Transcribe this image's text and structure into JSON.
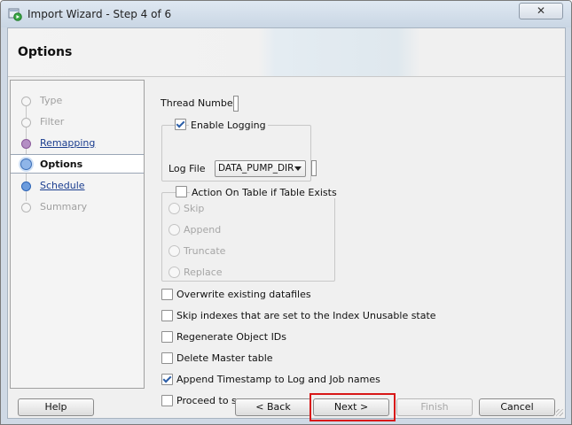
{
  "window": {
    "title": "Import Wizard - Step 4 of 6",
    "close_label": "✕"
  },
  "header": {
    "title": "Options"
  },
  "nav": {
    "items": [
      {
        "label": "Type"
      },
      {
        "label": "Filter"
      },
      {
        "label": "Remapping"
      },
      {
        "label": "Options"
      },
      {
        "label": "Schedule"
      },
      {
        "label": "Summary"
      }
    ]
  },
  "options": {
    "thread_number_label": "Thread Number",
    "thread_number_value": "",
    "enable_logging_label": "Enable Logging",
    "enable_logging_checked": true,
    "log_file_label": "Log File",
    "log_file_value": "DATA_PUMP_DIR",
    "log_file_name_value": "",
    "table_exists_label": "Action On Table if Table Exists",
    "table_exists_checked": false,
    "radio_options": [
      "Skip",
      "Append",
      "Truncate",
      "Replace"
    ],
    "checkboxes": [
      {
        "label": "Overwrite existing datafiles",
        "checked": false
      },
      {
        "label": "Skip indexes that are set to the Index Unusable state",
        "checked": false
      },
      {
        "label": "Regenerate Object IDs",
        "checked": false
      },
      {
        "label": "Delete Master table",
        "checked": false
      },
      {
        "label": "Append Timestamp to Log and Job names",
        "checked": true
      },
      {
        "label": "Proceed to summary.",
        "checked": false
      }
    ]
  },
  "buttons": {
    "help": "Help",
    "back": "< Back",
    "next": "Next >",
    "finish": "Finish",
    "cancel": "Cancel"
  },
  "colors": {
    "highlight": "#d81818",
    "link": "#1a3d8f",
    "active_step": "#3c6fb8"
  }
}
